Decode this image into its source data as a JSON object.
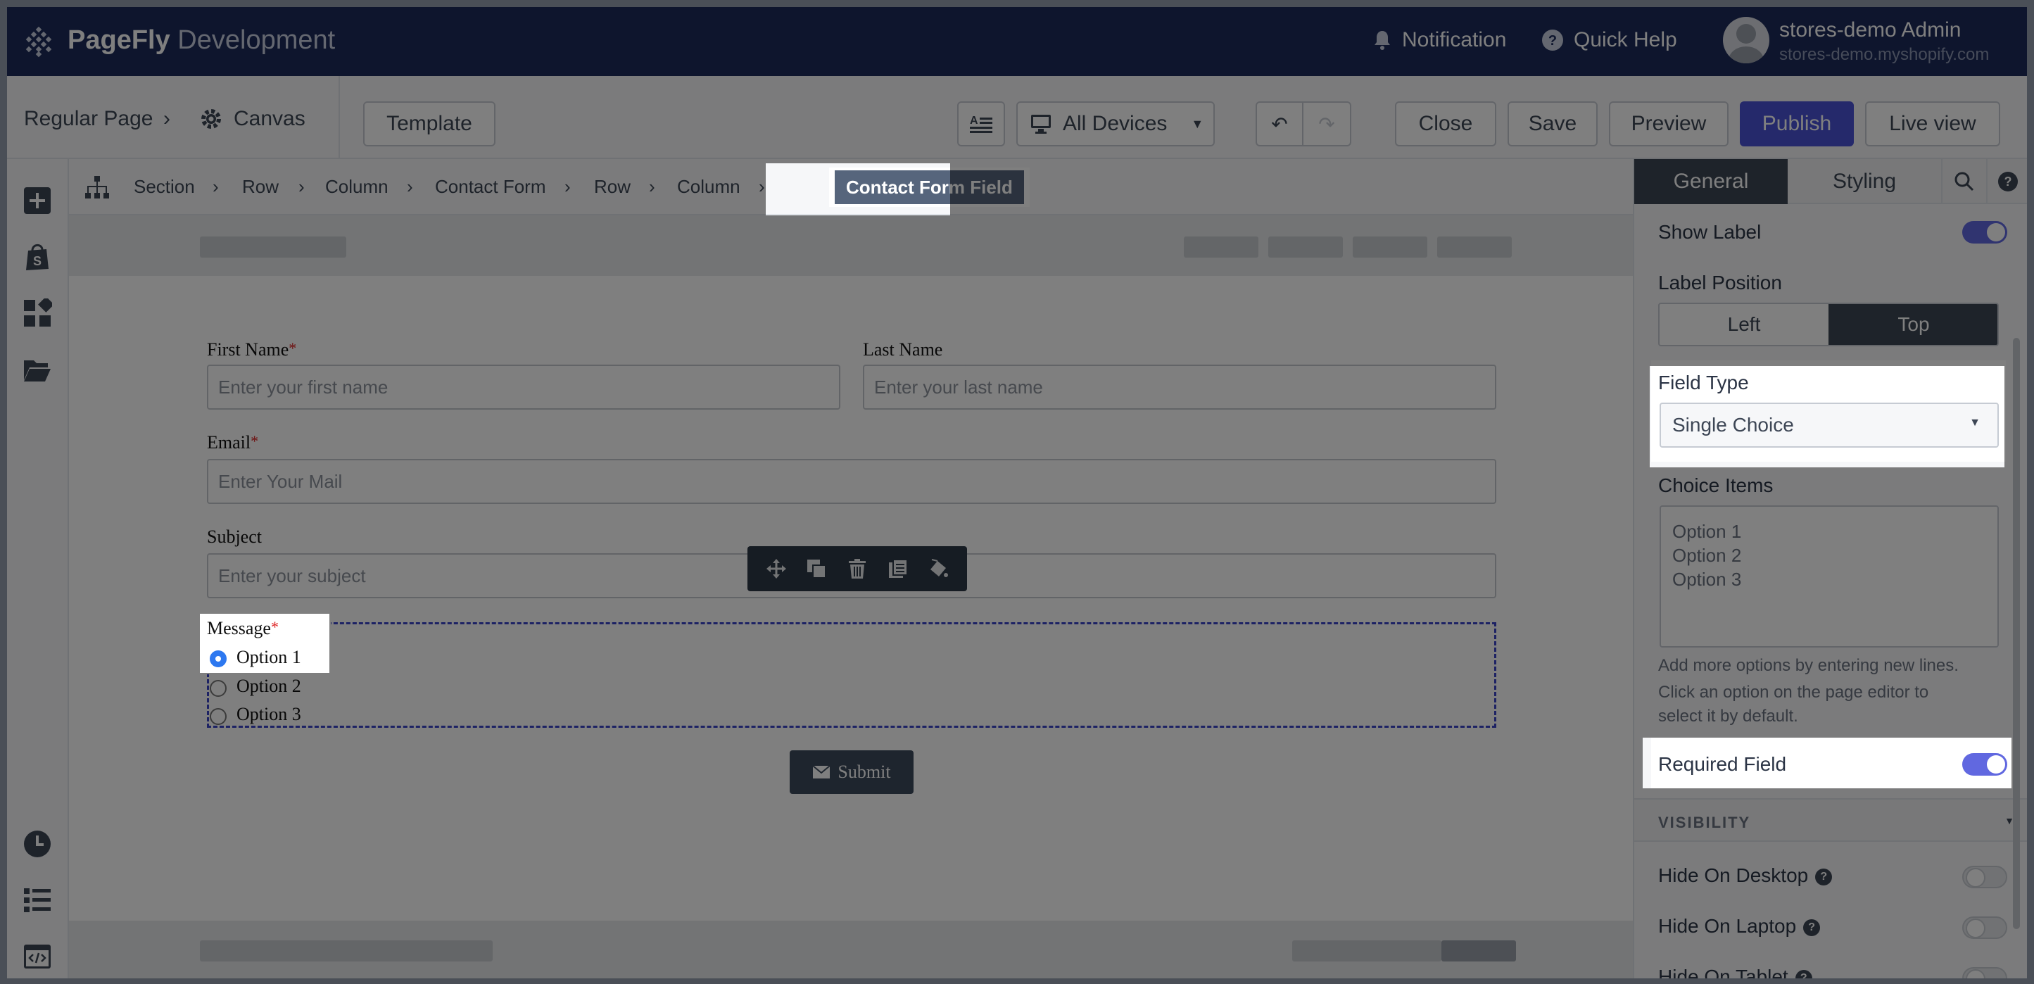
{
  "app": {
    "brand_bold": "PageFly",
    "brand_rest": "Development",
    "notification": "Notification",
    "quick_help": "Quick Help",
    "user_name": "stores-demo Admin",
    "user_store": "stores-demo.myshopify.com"
  },
  "toolbar": {
    "page_type": "Regular Page",
    "canvas": "Canvas",
    "template": "Template",
    "devices": "All Devices",
    "close": "Close",
    "save": "Save",
    "preview": "Preview",
    "publish": "Publish",
    "live_view": "Live view"
  },
  "breadcrumb": [
    "Section",
    "Row",
    "Column",
    "Contact Form",
    "Row",
    "Column",
    "Contact Form Field"
  ],
  "form": {
    "first_name_label": "First Name",
    "first_name_placeholder": "Enter your first name",
    "last_name_label": "Last Name",
    "last_name_placeholder": "Enter your last name",
    "email_label": "Email",
    "email_placeholder": "Enter Your Mail",
    "subject_label": "Subject",
    "subject_placeholder": "Enter your subject",
    "message_label": "Message",
    "options": [
      "Option 1",
      "Option 2",
      "Option 3"
    ],
    "selected_option": "Option 1",
    "submit": "Submit",
    "required_mark": "*"
  },
  "panel": {
    "tab_general": "General",
    "tab_styling": "Styling",
    "show_label": "Show Label",
    "show_label_on": true,
    "label_position": "Label Position",
    "pos_left": "Left",
    "pos_top": "Top",
    "pos_selected": "Top",
    "field_type": "Field Type",
    "field_type_value": "Single Choice",
    "choice_items": "Choice Items",
    "choice_items_value": "Option 1\nOption 2\nOption 3",
    "hint1": "Add more options by entering new lines.",
    "hint2": "Click an option on the page editor to",
    "hint3": "select it by default.",
    "required_field": "Required Field",
    "required_on": true,
    "visibility": "VISIBILITY",
    "hide_desktop": "Hide On Desktop",
    "hide_laptop": "Hide On Laptop",
    "hide_tablet": "Hide On Tablet",
    "help_mark": "?"
  },
  "colors": {
    "nav_bg": "#1c2b5a",
    "accent": "#4b52d6",
    "toggle_on": "#6168e0",
    "selection_dash": "#3b44c9"
  }
}
